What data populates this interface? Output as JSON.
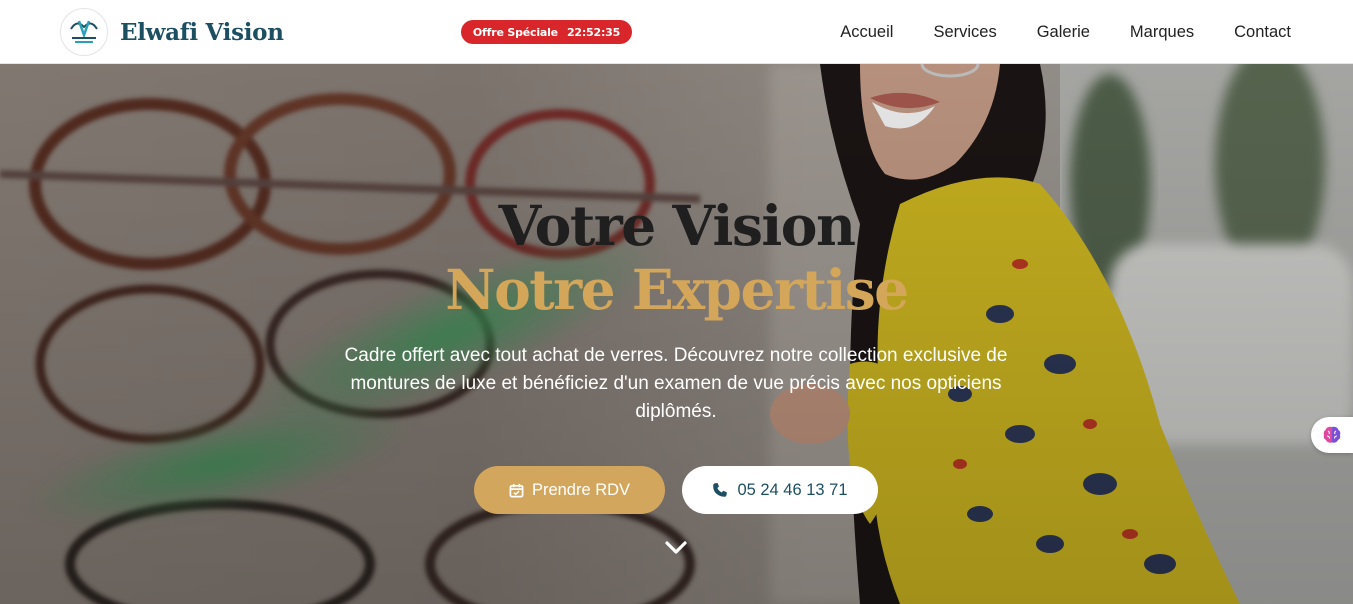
{
  "brand": {
    "name": "Elwafi Vision"
  },
  "promo": {
    "label": "Offre Spéciale",
    "timer": "22:52:35"
  },
  "nav": {
    "items": [
      "Accueil",
      "Services",
      "Galerie",
      "Marques",
      "Contact"
    ]
  },
  "hero": {
    "title_line1": "Votre Vision",
    "title_line2": "Notre Expertise",
    "subtitle": "Cadre offert avec tout achat de verres. Découvrez notre collection exclusive de montures de luxe et bénéficiez d'un examen de vue précis avec nos opticiens diplômés.",
    "cta_primary": "Prendre RDV",
    "cta_secondary": "05 24 46 13 71"
  },
  "colors": {
    "brand_blue": "#1d4f63",
    "gold": "#d4a659",
    "promo_red": "#d9262b"
  },
  "icons": {
    "primary_button": "calendar-icon",
    "secondary_button": "phone-icon",
    "scroll": "chevron-down-icon",
    "side_widget": "brain-icon"
  }
}
